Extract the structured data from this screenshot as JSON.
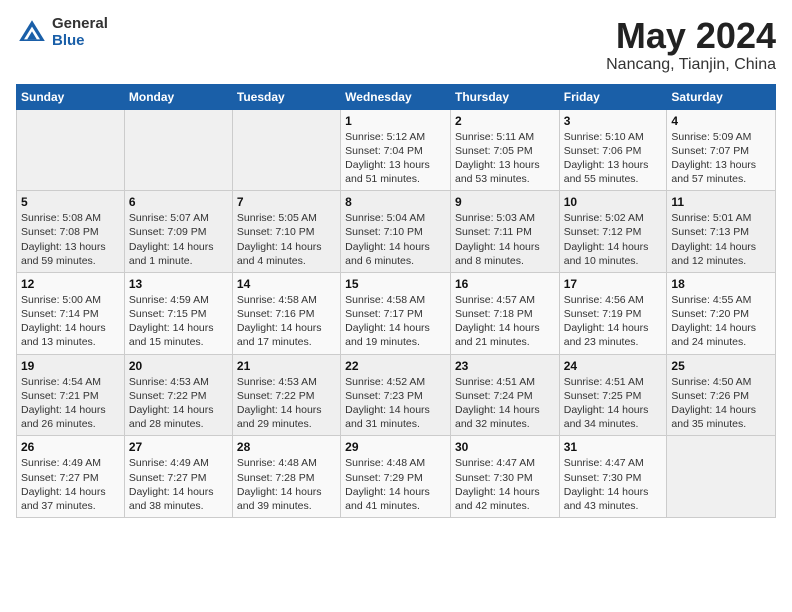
{
  "header": {
    "logo_general": "General",
    "logo_blue": "Blue",
    "month_year": "May 2024",
    "location": "Nancang, Tianjin, China"
  },
  "weekdays": [
    "Sunday",
    "Monday",
    "Tuesday",
    "Wednesday",
    "Thursday",
    "Friday",
    "Saturday"
  ],
  "weeks": [
    [
      {
        "day": "",
        "sunrise": "",
        "sunset": "",
        "daylight": ""
      },
      {
        "day": "",
        "sunrise": "",
        "sunset": "",
        "daylight": ""
      },
      {
        "day": "",
        "sunrise": "",
        "sunset": "",
        "daylight": ""
      },
      {
        "day": "1",
        "sunrise": "Sunrise: 5:12 AM",
        "sunset": "Sunset: 7:04 PM",
        "daylight": "Daylight: 13 hours and 51 minutes."
      },
      {
        "day": "2",
        "sunrise": "Sunrise: 5:11 AM",
        "sunset": "Sunset: 7:05 PM",
        "daylight": "Daylight: 13 hours and 53 minutes."
      },
      {
        "day": "3",
        "sunrise": "Sunrise: 5:10 AM",
        "sunset": "Sunset: 7:06 PM",
        "daylight": "Daylight: 13 hours and 55 minutes."
      },
      {
        "day": "4",
        "sunrise": "Sunrise: 5:09 AM",
        "sunset": "Sunset: 7:07 PM",
        "daylight": "Daylight: 13 hours and 57 minutes."
      }
    ],
    [
      {
        "day": "5",
        "sunrise": "Sunrise: 5:08 AM",
        "sunset": "Sunset: 7:08 PM",
        "daylight": "Daylight: 13 hours and 59 minutes."
      },
      {
        "day": "6",
        "sunrise": "Sunrise: 5:07 AM",
        "sunset": "Sunset: 7:09 PM",
        "daylight": "Daylight: 14 hours and 1 minute."
      },
      {
        "day": "7",
        "sunrise": "Sunrise: 5:05 AM",
        "sunset": "Sunset: 7:10 PM",
        "daylight": "Daylight: 14 hours and 4 minutes."
      },
      {
        "day": "8",
        "sunrise": "Sunrise: 5:04 AM",
        "sunset": "Sunset: 7:10 PM",
        "daylight": "Daylight: 14 hours and 6 minutes."
      },
      {
        "day": "9",
        "sunrise": "Sunrise: 5:03 AM",
        "sunset": "Sunset: 7:11 PM",
        "daylight": "Daylight: 14 hours and 8 minutes."
      },
      {
        "day": "10",
        "sunrise": "Sunrise: 5:02 AM",
        "sunset": "Sunset: 7:12 PM",
        "daylight": "Daylight: 14 hours and 10 minutes."
      },
      {
        "day": "11",
        "sunrise": "Sunrise: 5:01 AM",
        "sunset": "Sunset: 7:13 PM",
        "daylight": "Daylight: 14 hours and 12 minutes."
      }
    ],
    [
      {
        "day": "12",
        "sunrise": "Sunrise: 5:00 AM",
        "sunset": "Sunset: 7:14 PM",
        "daylight": "Daylight: 14 hours and 13 minutes."
      },
      {
        "day": "13",
        "sunrise": "Sunrise: 4:59 AM",
        "sunset": "Sunset: 7:15 PM",
        "daylight": "Daylight: 14 hours and 15 minutes."
      },
      {
        "day": "14",
        "sunrise": "Sunrise: 4:58 AM",
        "sunset": "Sunset: 7:16 PM",
        "daylight": "Daylight: 14 hours and 17 minutes."
      },
      {
        "day": "15",
        "sunrise": "Sunrise: 4:58 AM",
        "sunset": "Sunset: 7:17 PM",
        "daylight": "Daylight: 14 hours and 19 minutes."
      },
      {
        "day": "16",
        "sunrise": "Sunrise: 4:57 AM",
        "sunset": "Sunset: 7:18 PM",
        "daylight": "Daylight: 14 hours and 21 minutes."
      },
      {
        "day": "17",
        "sunrise": "Sunrise: 4:56 AM",
        "sunset": "Sunset: 7:19 PM",
        "daylight": "Daylight: 14 hours and 23 minutes."
      },
      {
        "day": "18",
        "sunrise": "Sunrise: 4:55 AM",
        "sunset": "Sunset: 7:20 PM",
        "daylight": "Daylight: 14 hours and 24 minutes."
      }
    ],
    [
      {
        "day": "19",
        "sunrise": "Sunrise: 4:54 AM",
        "sunset": "Sunset: 7:21 PM",
        "daylight": "Daylight: 14 hours and 26 minutes."
      },
      {
        "day": "20",
        "sunrise": "Sunrise: 4:53 AM",
        "sunset": "Sunset: 7:22 PM",
        "daylight": "Daylight: 14 hours and 28 minutes."
      },
      {
        "day": "21",
        "sunrise": "Sunrise: 4:53 AM",
        "sunset": "Sunset: 7:22 PM",
        "daylight": "Daylight: 14 hours and 29 minutes."
      },
      {
        "day": "22",
        "sunrise": "Sunrise: 4:52 AM",
        "sunset": "Sunset: 7:23 PM",
        "daylight": "Daylight: 14 hours and 31 minutes."
      },
      {
        "day": "23",
        "sunrise": "Sunrise: 4:51 AM",
        "sunset": "Sunset: 7:24 PM",
        "daylight": "Daylight: 14 hours and 32 minutes."
      },
      {
        "day": "24",
        "sunrise": "Sunrise: 4:51 AM",
        "sunset": "Sunset: 7:25 PM",
        "daylight": "Daylight: 14 hours and 34 minutes."
      },
      {
        "day": "25",
        "sunrise": "Sunrise: 4:50 AM",
        "sunset": "Sunset: 7:26 PM",
        "daylight": "Daylight: 14 hours and 35 minutes."
      }
    ],
    [
      {
        "day": "26",
        "sunrise": "Sunrise: 4:49 AM",
        "sunset": "Sunset: 7:27 PM",
        "daylight": "Daylight: 14 hours and 37 minutes."
      },
      {
        "day": "27",
        "sunrise": "Sunrise: 4:49 AM",
        "sunset": "Sunset: 7:27 PM",
        "daylight": "Daylight: 14 hours and 38 minutes."
      },
      {
        "day": "28",
        "sunrise": "Sunrise: 4:48 AM",
        "sunset": "Sunset: 7:28 PM",
        "daylight": "Daylight: 14 hours and 39 minutes."
      },
      {
        "day": "29",
        "sunrise": "Sunrise: 4:48 AM",
        "sunset": "Sunset: 7:29 PM",
        "daylight": "Daylight: 14 hours and 41 minutes."
      },
      {
        "day": "30",
        "sunrise": "Sunrise: 4:47 AM",
        "sunset": "Sunset: 7:30 PM",
        "daylight": "Daylight: 14 hours and 42 minutes."
      },
      {
        "day": "31",
        "sunrise": "Sunrise: 4:47 AM",
        "sunset": "Sunset: 7:30 PM",
        "daylight": "Daylight: 14 hours and 43 minutes."
      },
      {
        "day": "",
        "sunrise": "",
        "sunset": "",
        "daylight": ""
      }
    ]
  ]
}
